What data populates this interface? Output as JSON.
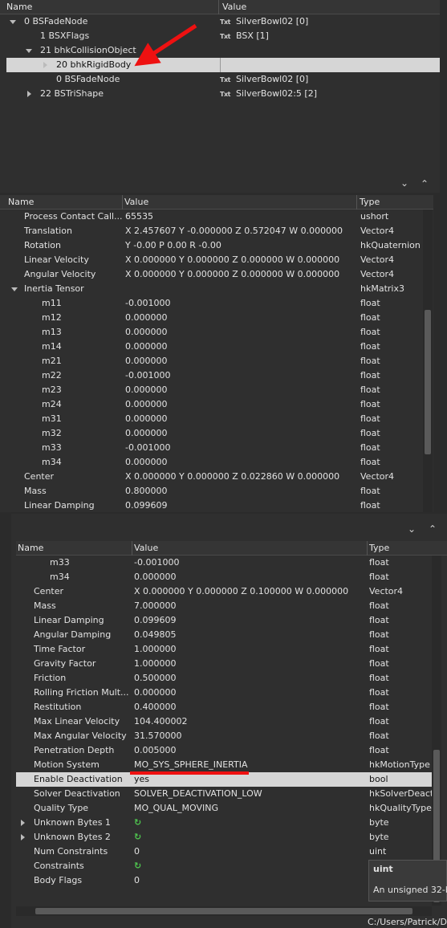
{
  "tree": {
    "headers": {
      "name": "Name",
      "value": "Value"
    },
    "rows": [
      {
        "name": "0 BSFadeNode",
        "value": "SilverBowl02 [0]"
      },
      {
        "name": "1 BSXFlags",
        "value": "BSX [1]"
      },
      {
        "name": "21 bhkCollisionObject",
        "value": ""
      },
      {
        "name": "20 bhkRigidBody",
        "value": ""
      },
      {
        "name": "0 BSFadeNode",
        "value": "SilverBowl02 [0]"
      },
      {
        "name": "22 BSTriShape",
        "value": "SilverBowl02:5 [2]"
      }
    ],
    "txt_icon": "Txt"
  },
  "block1": {
    "headers": {
      "name": "Name",
      "value": "Value",
      "type": "Type"
    },
    "rows": [
      {
        "name": "Process Contact Call...",
        "value": "65535",
        "type": "ushort"
      },
      {
        "name": "Translation",
        "value": "X 2.457607 Y -0.000000 Z 0.572047 W 0.000000",
        "type": "Vector4"
      },
      {
        "name": "Rotation",
        "value": "Y -0.00 P 0.00 R -0.00",
        "type": "hkQuaternion"
      },
      {
        "name": "Linear Velocity",
        "value": "X 0.000000 Y 0.000000 Z 0.000000 W 0.000000",
        "type": "Vector4"
      },
      {
        "name": "Angular Velocity",
        "value": "X 0.000000 Y 0.000000 Z 0.000000 W 0.000000",
        "type": "Vector4"
      },
      {
        "name": "Inertia Tensor",
        "value": "",
        "type": "hkMatrix3"
      },
      {
        "name": "m11",
        "value": "-0.001000",
        "type": "float"
      },
      {
        "name": "m12",
        "value": "0.000000",
        "type": "float"
      },
      {
        "name": "m13",
        "value": "0.000000",
        "type": "float"
      },
      {
        "name": "m14",
        "value": "0.000000",
        "type": "float"
      },
      {
        "name": "m21",
        "value": "0.000000",
        "type": "float"
      },
      {
        "name": "m22",
        "value": "-0.001000",
        "type": "float"
      },
      {
        "name": "m23",
        "value": "0.000000",
        "type": "float"
      },
      {
        "name": "m24",
        "value": "0.000000",
        "type": "float"
      },
      {
        "name": "m31",
        "value": "0.000000",
        "type": "float"
      },
      {
        "name": "m32",
        "value": "0.000000",
        "type": "float"
      },
      {
        "name": "m33",
        "value": "-0.001000",
        "type": "float"
      },
      {
        "name": "m34",
        "value": "0.000000",
        "type": "float"
      },
      {
        "name": "Center",
        "value": "X 0.000000 Y 0.000000 Z 0.022860 W 0.000000",
        "type": "Vector4"
      },
      {
        "name": "Mass",
        "value": "0.800000",
        "type": "float"
      },
      {
        "name": "Linear Damping",
        "value": "0.099609",
        "type": "float"
      }
    ]
  },
  "block2": {
    "headers": {
      "name": "Name",
      "value": "Value",
      "type": "Type"
    },
    "rows": [
      {
        "name": "m33",
        "value": "-0.001000",
        "type": "float"
      },
      {
        "name": "m34",
        "value": "0.000000",
        "type": "float"
      },
      {
        "name": "Center",
        "value": "X 0.000000 Y 0.000000 Z 0.100000 W 0.000000",
        "type": "Vector4"
      },
      {
        "name": "Mass",
        "value": "7.000000",
        "type": "float"
      },
      {
        "name": "Linear Damping",
        "value": "0.099609",
        "type": "float"
      },
      {
        "name": "Angular Damping",
        "value": "0.049805",
        "type": "float"
      },
      {
        "name": "Time Factor",
        "value": "1.000000",
        "type": "float"
      },
      {
        "name": "Gravity Factor",
        "value": "1.000000",
        "type": "float"
      },
      {
        "name": "Friction",
        "value": "0.500000",
        "type": "float"
      },
      {
        "name": "Rolling Friction Mult...",
        "value": "0.000000",
        "type": "float"
      },
      {
        "name": "Restitution",
        "value": "0.400000",
        "type": "float"
      },
      {
        "name": "Max Linear Velocity",
        "value": "104.400002",
        "type": "float"
      },
      {
        "name": "Max Angular Velocity",
        "value": "31.570000",
        "type": "float"
      },
      {
        "name": "Penetration Depth",
        "value": "0.005000",
        "type": "float"
      },
      {
        "name": "Motion System",
        "value": "MO_SYS_SPHERE_INERTIA",
        "type": "hkMotionType"
      },
      {
        "name": "Enable Deactivation",
        "value": "yes",
        "type": "bool"
      },
      {
        "name": "Solver Deactivation",
        "value": "SOLVER_DEACTIVATION_LOW",
        "type": "hkSolverDeacti"
      },
      {
        "name": "Quality Type",
        "value": "MO_QUAL_MOVING",
        "type": "hkQualityType"
      },
      {
        "name": "Unknown Bytes 1",
        "value": "",
        "type": "byte"
      },
      {
        "name": "Unknown Bytes 2",
        "value": "",
        "type": "byte"
      },
      {
        "name": "Num Constraints",
        "value": "0",
        "type": "uint"
      },
      {
        "name": "Constraints",
        "value": "",
        "type": ""
      },
      {
        "name": "Body Flags",
        "value": "0",
        "type": ""
      }
    ],
    "tooltip": {
      "title": "uint",
      "body": "An unsigned 32-b"
    },
    "status_path": "C:/Users/Patrick/D"
  },
  "colors": {
    "accent_red": "#e11111",
    "selection": "#d6d6d6",
    "refresh_green": "#4ec34e"
  }
}
